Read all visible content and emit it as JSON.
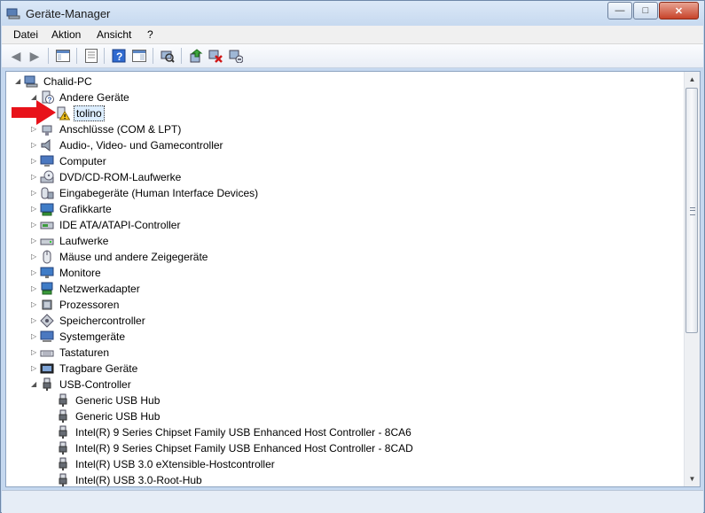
{
  "window": {
    "title": "Geräte-Manager",
    "caption_minimize": "—",
    "caption_maximize": "□",
    "caption_close": "✕"
  },
  "menu": [
    "Datei",
    "Aktion",
    "Ansicht",
    "?"
  ],
  "toolbar": {
    "buttons": [
      "back-icon",
      "forward-icon",
      "show-hide-tree-icon",
      "properties-icon",
      "help-icon",
      "view-icon",
      "scan-hardware-icon",
      "update-driver-icon",
      "disable-device-icon",
      "uninstall-device-icon"
    ]
  },
  "tree": {
    "root": "Chalid-PC",
    "items": [
      {
        "label": "Andere Geräte",
        "level": 1,
        "expanded": true,
        "icon": "unknown-device-icon"
      },
      {
        "label": "tolino",
        "level": 2,
        "selected": true,
        "icon": "warning-device-icon"
      },
      {
        "label": "Anschlüsse (COM & LPT)",
        "level": 1,
        "icon": "port-icon"
      },
      {
        "label": "Audio-, Video- und Gamecontroller",
        "level": 1,
        "icon": "speaker-icon"
      },
      {
        "label": "Computer",
        "level": 1,
        "icon": "computer-icon"
      },
      {
        "label": "DVD/CD-ROM-Laufwerke",
        "level": 1,
        "icon": "dvd-drive-icon"
      },
      {
        "label": "Eingabegeräte (Human Interface Devices)",
        "level": 1,
        "icon": "hid-icon"
      },
      {
        "label": "Grafikkarte",
        "level": 1,
        "icon": "display-adapter-icon"
      },
      {
        "label": "IDE ATA/ATAPI-Controller",
        "level": 1,
        "icon": "ide-controller-icon"
      },
      {
        "label": "Laufwerke",
        "level": 1,
        "icon": "disk-drive-icon"
      },
      {
        "label": "Mäuse und andere Zeigegeräte",
        "level": 1,
        "icon": "mouse-icon"
      },
      {
        "label": "Monitore",
        "level": 1,
        "icon": "monitor-icon"
      },
      {
        "label": "Netzwerkadapter",
        "level": 1,
        "icon": "network-adapter-icon"
      },
      {
        "label": "Prozessoren",
        "level": 1,
        "icon": "processor-icon"
      },
      {
        "label": "Speichercontroller",
        "level": 1,
        "icon": "storage-controller-icon"
      },
      {
        "label": "Systemgeräte",
        "level": 1,
        "icon": "system-device-icon"
      },
      {
        "label": "Tastaturen",
        "level": 1,
        "icon": "keyboard-icon"
      },
      {
        "label": "Tragbare Geräte",
        "level": 1,
        "icon": "portable-device-icon"
      },
      {
        "label": "USB-Controller",
        "level": 1,
        "expanded": true,
        "icon": "usb-icon"
      },
      {
        "label": "Generic USB Hub",
        "level": 2,
        "icon": "usb-icon"
      },
      {
        "label": "Generic USB Hub",
        "level": 2,
        "icon": "usb-icon"
      },
      {
        "label": "Intel(R) 9 Series Chipset Family USB Enhanced Host Controller  - 8CA6",
        "level": 2,
        "icon": "usb-icon"
      },
      {
        "label": "Intel(R) 9 Series Chipset Family USB Enhanced Host Controller  - 8CAD",
        "level": 2,
        "icon": "usb-icon"
      },
      {
        "label": "Intel(R) USB 3.0 eXtensible-Hostcontroller",
        "level": 2,
        "icon": "usb-icon"
      },
      {
        "label": "Intel(R) USB 3.0-Root-Hub",
        "level": 2,
        "icon": "usb-icon"
      }
    ]
  },
  "colors": {
    "annotation_arrow": "#e8121a",
    "warning": "#f2c21a",
    "selection": "#ddeeff"
  }
}
